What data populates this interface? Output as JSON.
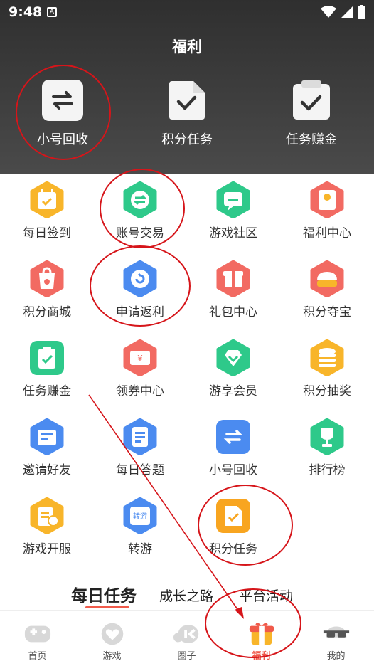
{
  "status": {
    "time": "9:48",
    "a_badge": "A"
  },
  "header": {
    "title": "福利"
  },
  "top_items": [
    {
      "label": "小号回收",
      "icon": "swap-arrows-icon"
    },
    {
      "label": "积分任务",
      "icon": "document-check-icon"
    },
    {
      "label": "任务赚金",
      "icon": "clipboard-check-icon"
    }
  ],
  "grid": [
    {
      "label": "每日签到",
      "icon": "calendar-check-icon",
      "color": "#f8b52a"
    },
    {
      "label": "账号交易",
      "icon": "swap-circle-icon",
      "color": "#2ec98a"
    },
    {
      "label": "游戏社区",
      "icon": "chat-bubble-icon",
      "color": "#2ec98a"
    },
    {
      "label": "福利中心",
      "icon": "red-envelope-icon",
      "color": "#f26a62"
    },
    {
      "label": "积分商城",
      "icon": "shopping-bag-icon",
      "color": "#f26a62"
    },
    {
      "label": "申请返利",
      "icon": "refresh-circle-icon",
      "color": "#4b8bf0"
    },
    {
      "label": "礼包中心",
      "icon": "gift-icon",
      "color": "#f26a62"
    },
    {
      "label": "积分夺宝",
      "icon": "treasure-icon",
      "color": "#f26a62"
    },
    {
      "label": "任务赚金",
      "icon": "clipboard-check-icon",
      "color": "#2ec98a"
    },
    {
      "label": "领券中心",
      "icon": "coupon-icon",
      "color": "#f26a62"
    },
    {
      "label": "游享会员",
      "icon": "diamond-icon",
      "color": "#2ec98a"
    },
    {
      "label": "积分抽奖",
      "icon": "coin-stack-icon",
      "color": "#f8b52a"
    },
    {
      "label": "邀请好友",
      "icon": "mail-icon",
      "color": "#4b8bf0"
    },
    {
      "label": "每日答题",
      "icon": "notes-icon",
      "color": "#4b8bf0"
    },
    {
      "label": "小号回收",
      "icon": "swap-arrows-icon",
      "color": "#4b8bf0"
    },
    {
      "label": "排行榜",
      "icon": "trophy-icon",
      "color": "#2ec98a"
    },
    {
      "label": "游戏开服",
      "icon": "server-clock-icon",
      "color": "#f8b52a"
    },
    {
      "label": "转游",
      "icon": "transfer-game-icon",
      "color": "#4b8bf0"
    },
    {
      "label": "积分任务",
      "icon": "document-check-icon",
      "color": "#f8a520"
    }
  ],
  "tabs": {
    "daily": "每日任务",
    "growth": "成长之路",
    "platform": "平台活动"
  },
  "nav": [
    {
      "label": "首页",
      "icon": "gamepad-icon"
    },
    {
      "label": "游戏",
      "icon": "heart-controller-icon"
    },
    {
      "label": "圈子",
      "icon": "community-icon"
    },
    {
      "label": "福利",
      "icon": "gift-box-icon"
    },
    {
      "label": "我的",
      "icon": "sunglasses-face-icon"
    }
  ],
  "colors": {
    "accent": "#f05a4a",
    "annotation": "#d6151a"
  }
}
